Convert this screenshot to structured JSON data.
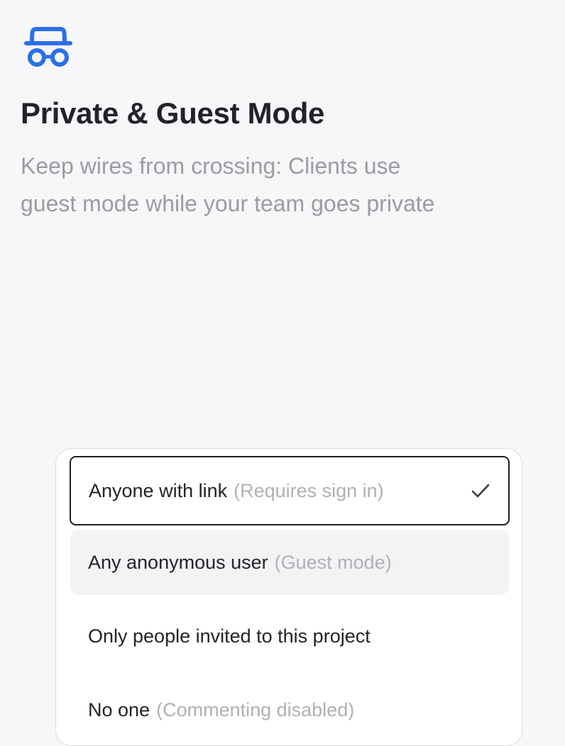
{
  "header": {
    "title": "Private & Guest Mode",
    "subtitle": "Keep wires from crossing: Clients use guest mode while your team goes private",
    "icon": "incognito-icon",
    "accent_color": "#2b6fe8"
  },
  "access_menu": {
    "options": [
      {
        "label": "Anyone with link",
        "hint": "(Requires sign in)",
        "selected": true
      },
      {
        "label": "Any anonymous user",
        "hint": "(Guest mode)",
        "selected": false,
        "hovered": true
      },
      {
        "label": "Only people invited to this project",
        "hint": "",
        "selected": false
      },
      {
        "label": "No one",
        "hint": "(Commenting disabled)",
        "selected": false
      }
    ],
    "selected_icon": "checkmark-icon"
  }
}
